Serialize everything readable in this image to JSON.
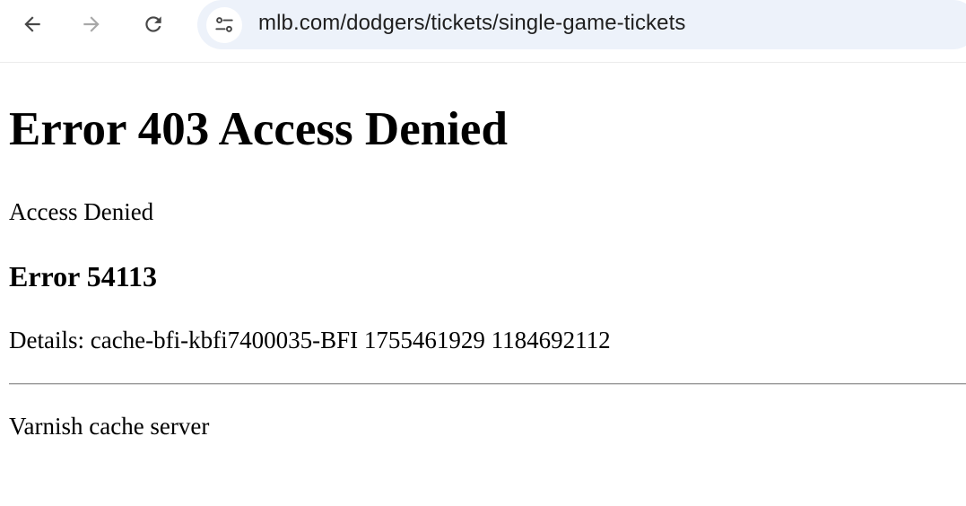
{
  "browser": {
    "url": "mlb.com/dodgers/tickets/single-game-tickets",
    "icons": {
      "back": "arrow-left-icon",
      "forward": "arrow-right-icon",
      "reload": "reload-icon",
      "site_info": "tune-icon"
    },
    "colors": {
      "omnibox_bg": "#edf2fa",
      "icon_color": "#474747",
      "icon_disabled": "#a8a8a8"
    }
  },
  "page": {
    "heading": "Error 403 Access Denied",
    "message": "Access Denied",
    "error_code_heading": "Error 54113",
    "details": "Details: cache-bfi-kbfi7400035-BFI 1755461929 1184692112",
    "footer": "Varnish cache server"
  }
}
